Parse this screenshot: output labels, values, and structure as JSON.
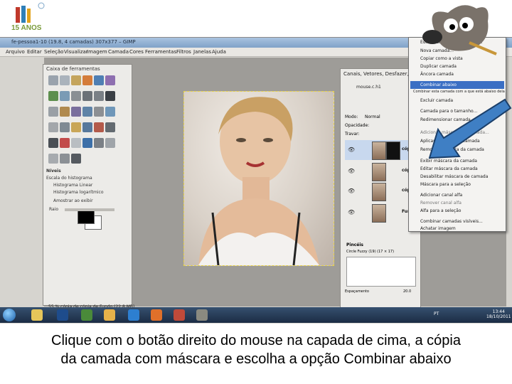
{
  "logo": {
    "text": "15 ANOS"
  },
  "window": {
    "title": "fe-pessoa1-10 (19.8, 4 camadas) 307x377 – GIMP"
  },
  "menubar": [
    "Arquivo",
    "Editar",
    "Seleção",
    "Visualizar",
    "Imagem",
    "Camada",
    "Cores",
    "Ferramentas",
    "Filtros",
    "Janelas",
    "Ajuda"
  ],
  "toolbox": {
    "title": "Caixa de ferramentas",
    "histogram_label": "Níveis",
    "scale_label": "Escala do histograma",
    "linear": "Histograma Linear",
    "log": "Histograma logarítmico",
    "preview": "Amostrar ao exibir",
    "raio_label": "Raio"
  },
  "layers_panel": {
    "title": "Canais, Vetores, Desfazer, Camadas",
    "image_name": "mouse.c.h1",
    "mode_label": "Modo:",
    "mode_value": "Normal",
    "opacity_label": "Opacidade:",
    "lock_label": "Travar:",
    "layers": [
      {
        "name": "cópia"
      },
      {
        "name": "cópia de fundo"
      },
      {
        "name": "cópia"
      },
      {
        "name": "Fundo"
      }
    ],
    "brushes_title": "Pincéis",
    "brush_name": "Circle Fuzzy (19) (17 × 17)",
    "spacing_label": "Espaçamento",
    "spacing_value": "20.0"
  },
  "context_menu": {
    "items": [
      "Editar atributos da camada...",
      "Nova camada...",
      "Copiar como a vista",
      "Duplicar camada",
      "Âncora camada",
      "Combinar abaixo",
      "Combinar esta camada com a que está abaixo dela",
      "Excluir camada",
      "Camada para o tamanho...",
      "Redimensionar camada...",
      "Adicionar máscara de camada...",
      "Aplicar máscara de camada",
      "Remover máscara da camada",
      "Exibir máscara da camada",
      "Editar máscara da camada",
      "Desabilitar máscara de camada",
      "Máscara para a seleção",
      "Adicionar canal alfa",
      "Remover canal alfa",
      "Alfa para a seleção",
      "Combinar camadas visíveis...",
      "Achatar imagem"
    ],
    "highlighted_index": 5
  },
  "status_bar": "55 % cópia de cópia de Fundo (22,8 MB)",
  "taskbar": {
    "time": "13:44",
    "date": "18/10/2011",
    "lang": "PT"
  },
  "caption": {
    "line1": "Clique com o botão direito do mouse na capada de cima, a cópia",
    "line2": "da camada com máscara e escolha a opção Combinar abaixo"
  }
}
